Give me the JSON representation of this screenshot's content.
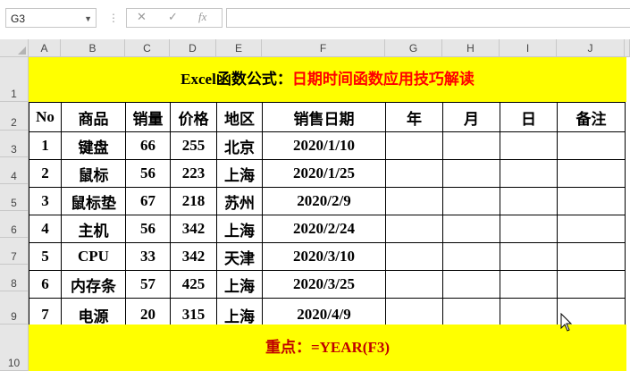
{
  "formula_bar": {
    "name_box": "G3",
    "cancel_icon": "✕",
    "enter_icon": "✓",
    "fx_label": "fx",
    "formula": ""
  },
  "column_headers": [
    "A",
    "B",
    "C",
    "D",
    "E",
    "F",
    "G",
    "H",
    "I",
    "J"
  ],
  "row_headers": [
    "1",
    "2",
    "3",
    "4",
    "5",
    "6",
    "7",
    "8",
    "9",
    "10"
  ],
  "title": {
    "black_part": "Excel函数公式：",
    "red_part": "日期时间函数应用技巧解读"
  },
  "table": {
    "headers": [
      "No",
      "商品",
      "销量",
      "价格",
      "地区",
      "销售日期",
      "年",
      "月",
      "日",
      "备注"
    ],
    "rows": [
      [
        "1",
        "键盘",
        "66",
        "255",
        "北京",
        "2020/1/10",
        "",
        "",
        "",
        ""
      ],
      [
        "2",
        "鼠标",
        "56",
        "223",
        "上海",
        "2020/1/25",
        "",
        "",
        "",
        ""
      ],
      [
        "3",
        "鼠标垫",
        "67",
        "218",
        "苏州",
        "2020/2/9",
        "",
        "",
        "",
        ""
      ],
      [
        "4",
        "主机",
        "56",
        "342",
        "上海",
        "2020/2/24",
        "",
        "",
        "",
        ""
      ],
      [
        "5",
        "CPU",
        "33",
        "342",
        "天津",
        "2020/3/10",
        "",
        "",
        "",
        ""
      ],
      [
        "6",
        "内存条",
        "57",
        "425",
        "上海",
        "2020/3/25",
        "",
        "",
        "",
        ""
      ],
      [
        "7",
        "电源",
        "20",
        "315",
        "上海",
        "2020/4/9",
        "",
        "",
        "",
        ""
      ]
    ]
  },
  "footer": {
    "text": "重点：=YEAR(F3)"
  },
  "colors": {
    "highlight": "#ffff00",
    "title_red": "#ff0000",
    "footer_text": "#c00000",
    "header_bg": "#e6e6e6"
  },
  "icons": {
    "cursor": "mouse-pointer-icon"
  }
}
